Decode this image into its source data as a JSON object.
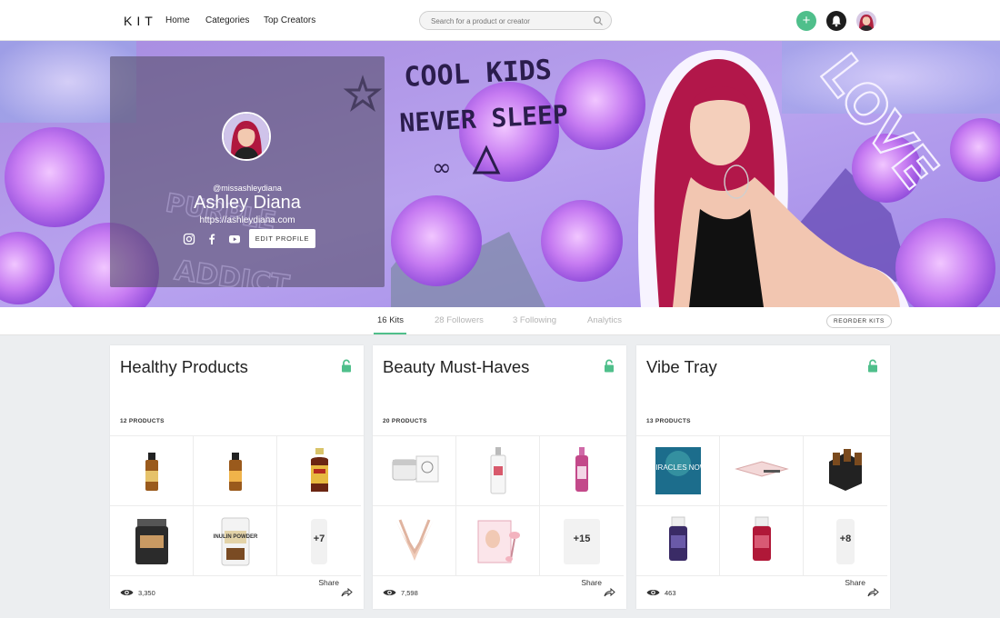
{
  "nav": {
    "logo": "KIT",
    "links": [
      "Home",
      "Categories",
      "Top Creators"
    ],
    "search_placeholder": "Search for a product or creator"
  },
  "profile": {
    "handle": "@missashleydiana",
    "name": "Ashley Diana",
    "url": "https://ashleydiana.com",
    "edit_label": "EDIT PROFILE"
  },
  "banner": {
    "texts": [
      "COOL KIDS",
      "NEVER SLEEP",
      "LOVE",
      "PURPLE",
      "ADDICT"
    ]
  },
  "tabs": [
    {
      "label": "16 Kits",
      "active": true
    },
    {
      "label": "28 Followers",
      "active": false
    },
    {
      "label": "3 Following",
      "active": false
    },
    {
      "label": "Analytics",
      "active": false
    }
  ],
  "reorder_label": "REORDER KITS",
  "kits": [
    {
      "title": "Healthy Products",
      "count": "12 PRODUCTS",
      "more": "+7",
      "share": "Share",
      "views": "3,350"
    },
    {
      "title": "Beauty Must-Haves",
      "count": "20 PRODUCTS",
      "more": "+15",
      "share": "Share",
      "views": "7,598"
    },
    {
      "title": "Vibe Tray",
      "count": "13 PRODUCTS",
      "more": "+8",
      "share": "Share",
      "views": "463"
    }
  ],
  "product_texts": {
    "inulin": "INULIN POWDER",
    "miracles": "MIRACLES NOW"
  },
  "colors": {
    "accent": "#4fbf8b",
    "purple": "#8a5cf0",
    "text": "#222222"
  },
  "icons": [
    "search-icon",
    "plus-icon",
    "bell-icon",
    "instagram-icon",
    "facebook-icon",
    "youtube-icon",
    "lock-icon",
    "eye-icon",
    "share-icon"
  ]
}
